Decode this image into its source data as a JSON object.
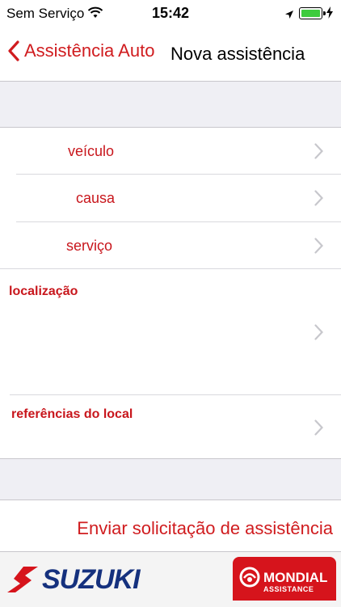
{
  "status_bar": {
    "carrier": "Sem Serviço",
    "time": "15:42"
  },
  "navbar": {
    "back_label": "Assistência Auto",
    "title": "Nova assistência"
  },
  "form": {
    "rows": [
      {
        "label": "veículo"
      },
      {
        "label": "causa"
      },
      {
        "label": "serviço"
      },
      {
        "label": "localização"
      },
      {
        "label": "referências do local"
      }
    ]
  },
  "actions": {
    "send_label": "Enviar solicitação de assistência"
  },
  "footer": {
    "brand_left": "SUZUKI",
    "brand_right": "MONDIAL",
    "brand_right_sub": "ASSISTANCE"
  },
  "colors": {
    "accent": "#d01c1f",
    "suzuki_blue": "#15317e"
  }
}
